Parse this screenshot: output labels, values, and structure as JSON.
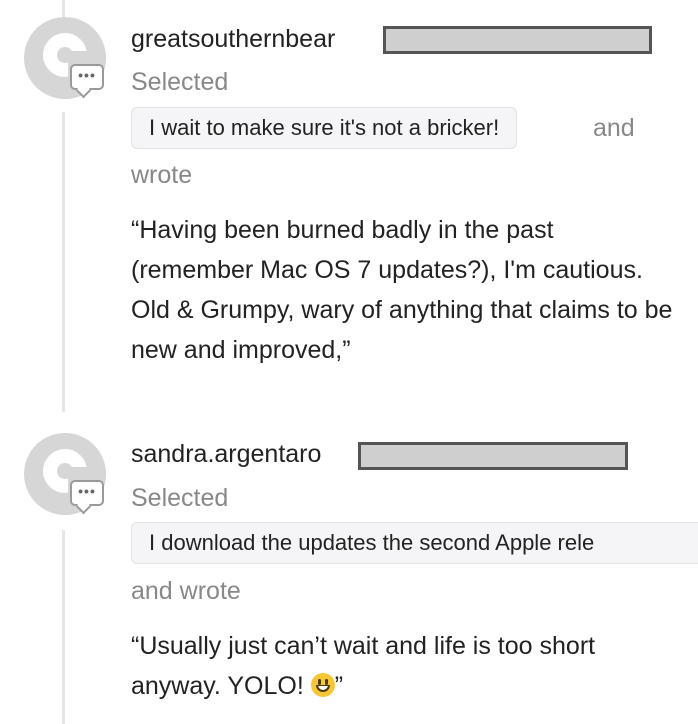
{
  "entries": [
    {
      "username": "greatsouthernbear",
      "selected_label": "Selected",
      "selection": "I wait to make sure it's not a bricker!",
      "and_label": "and",
      "wrote_label": "wrote",
      "quote": "“Having been burned badly in the past (remember Mac OS 7 updates?), I'm cautious. Old & Grumpy, wary of anything that claims to be new and improved,”"
    },
    {
      "username": "sandra.argentaro",
      "selected_label": "Selected",
      "selection": "I download the updates the second Apple rele",
      "and_wrote_label": "and wrote",
      "quote_before_emoji": "“Usually just can’t wait and life is too short anyway. YOLO!",
      "emoji": "grinning-face-emoji",
      "quote_after_emoji": "”"
    }
  ],
  "icons": {
    "avatar": "default-avatar-icon",
    "badge": "comment-bubble-icon",
    "badge_dots": "•••"
  },
  "colors": {
    "text": "#222222",
    "muted": "#888888",
    "chip_bg": "#f5f5f7",
    "timeline": "#e6e6e6",
    "emoji": "#f7c634"
  }
}
